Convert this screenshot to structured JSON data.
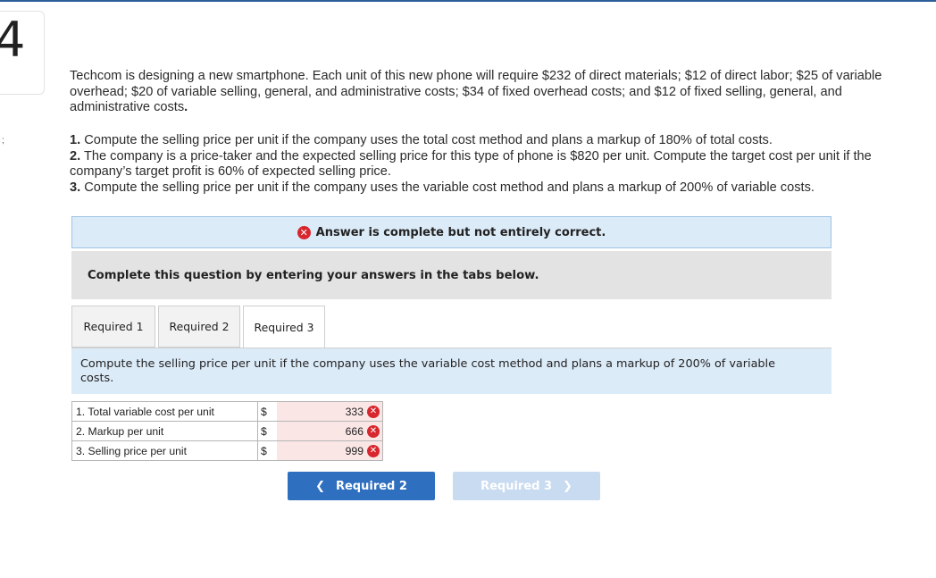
{
  "question": {
    "number": "4",
    "side_mark": ";",
    "intro_text": "Techcom is designing a new smartphone. Each unit of this new phone will require $232 of direct materials; $12 of direct labor; $25 of variable overhead; $20 of variable selling, general, and administrative costs; $34 of fixed overhead costs; and $12 of fixed selling, general, and administrative costs",
    "intro_end": ".",
    "requirements": [
      {
        "num": "1.",
        "text": " Compute the selling price per unit if the company uses the total cost method and plans a markup of 180% of total costs."
      },
      {
        "num": "2.",
        "text": " The company is a price-taker and the expected selling price for this type of phone is $820 per unit. Compute the target cost per unit if the company’s target profit is 60% of expected selling price."
      },
      {
        "num": "3.",
        "text": " Compute the selling price per unit if the company uses the variable cost method and plans a markup of 200% of variable costs."
      }
    ]
  },
  "alert": {
    "icon": "x-circle-icon",
    "symbol": "✕",
    "text": "Answer is complete but not entirely correct.",
    "color": "#d7262e"
  },
  "instruction": "Complete this question by entering your answers in the tabs below.",
  "tabs": [
    {
      "label": "Required 1",
      "active": false
    },
    {
      "label": "Required 2",
      "active": false
    },
    {
      "label": "Required 3",
      "active": true
    }
  ],
  "prompt": "Compute the selling price per unit if the company uses the variable cost method and plans a markup of 200% of variable costs.",
  "answer_rows": [
    {
      "label": "1. Total variable cost per unit",
      "currency": "$",
      "value": "333",
      "status": "incorrect"
    },
    {
      "label": "2. Markup per unit",
      "currency": "$",
      "value": "666",
      "status": "incorrect"
    },
    {
      "label": "3. Selling price per unit",
      "currency": "$",
      "value": "999",
      "status": "incorrect"
    }
  ],
  "nav": {
    "prev_label": "Required 2",
    "prev_icon": "chevron-left-icon",
    "prev_symbol": "❮",
    "next_label": "Required 3",
    "next_icon": "chevron-right-icon",
    "next_symbol": "❯"
  },
  "colors": {
    "accent": "#2f6fbf",
    "error": "#d7262e",
    "info_bg": "#dcebf8",
    "incorrect_cell": "#fbe6e6"
  }
}
